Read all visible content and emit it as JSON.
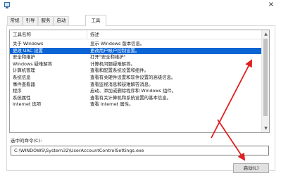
{
  "window": {
    "close_glyph": "×"
  },
  "tabs": [
    {
      "label": "常规"
    },
    {
      "label": "引导"
    },
    {
      "label": "服务"
    },
    {
      "label": "启动"
    },
    {
      "label": "工具"
    }
  ],
  "active_tab": 4,
  "list": {
    "columns": [
      "工具名称",
      "描述"
    ],
    "rows": [
      {
        "name": "关于 Windows",
        "desc": "显示 Windows 版本信息。"
      },
      {
        "name": "更改 UAC 设置",
        "desc": "更改用户帐户控制设置。",
        "selected": true
      },
      {
        "name": "安全和维护",
        "desc": "打开\"安全和维护\""
      },
      {
        "name": "Windows 疑难解答",
        "desc": "计算机问题疑难解答。"
      },
      {
        "name": "计算机管理",
        "desc": "查看和配置系统设置和组件。"
      },
      {
        "name": "系统信息",
        "desc": "查看有关硬件设置和软件设置的高级信息。"
      },
      {
        "name": "事件查看器",
        "desc": "查看监视消息和疑难解答消息。"
      },
      {
        "name": "程序",
        "desc": "启动、添加或删除程序和 Windows 组件。"
      },
      {
        "name": "系统属性",
        "desc": "查看有关计算机和系统设置的基本信息。"
      },
      {
        "name": "Internet 选项",
        "desc": "查看 Internet 属性。"
      }
    ]
  },
  "command": {
    "label": "选中的命令(C):",
    "value": "C:\\WINDOWS\\System32\\UserAccountControlSettings.exe"
  },
  "buttons": {
    "launch": "启动(L)"
  },
  "annotation_color": "#e02020"
}
